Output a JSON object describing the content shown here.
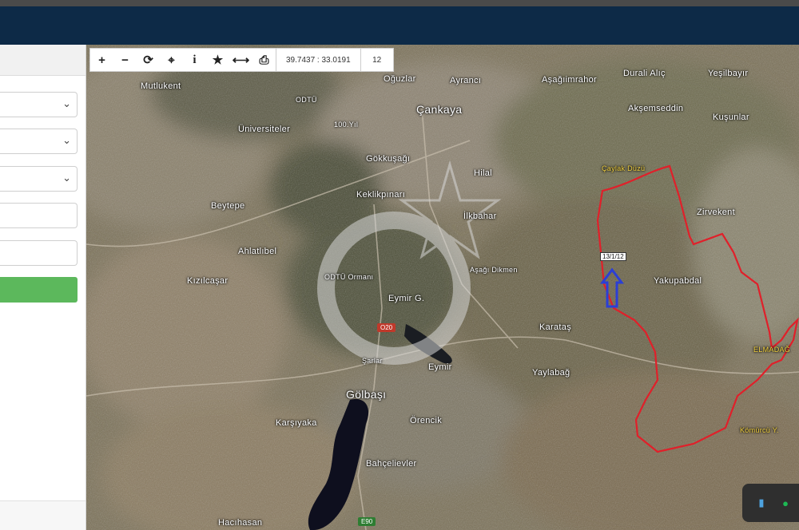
{
  "toolbar": {
    "buttons": [
      {
        "name": "zoom-in-icon",
        "glyph": "+"
      },
      {
        "name": "zoom-out-icon",
        "glyph": "−"
      },
      {
        "name": "refresh-icon",
        "glyph": "⟳"
      },
      {
        "name": "locate-icon",
        "glyph": "⌖"
      },
      {
        "name": "info-icon",
        "glyph": "i"
      },
      {
        "name": "favorite-star-icon",
        "glyph": "★"
      },
      {
        "name": "measure-icon",
        "glyph": "⟷"
      },
      {
        "name": "print-icon",
        "glyph": "⎙"
      }
    ],
    "coordinates": "39.7437 : 33.0191",
    "zoom": "12"
  },
  "map": {
    "labels": {
      "mutlukent": "Mutlukent",
      "odtu": "ODTÜ",
      "universiteler": "Üniversiteler",
      "yuzuncu_yil": "100.Yıl",
      "oguzlar": "Oğuzlar",
      "ayranci": "Ayrancı",
      "cankaya": "Çankaya",
      "asagi_imrahor": "Aşağıimrahor",
      "durali_alic": "Durali Alıç",
      "yesilbayir": "Yeşilbayır",
      "aksemseddin": "Akşemseddin",
      "kusunlar": "Kuşunlar",
      "gokkusagi": "Gökkuşağı",
      "hilal": "Hilal",
      "caylak_duzu": "Çaylak Düzü",
      "keklikpinari": "Keklikpınarı",
      "ikbahar": "İlkbahar",
      "beytepe": "Beytepe",
      "zirvekent": "Zirvekent",
      "ahlatlibel": "Ahlatlıbel",
      "odtu_ormani": "ODTÜ Ormanı",
      "asagi_dikmen": "Aşağı Dikmen",
      "yakupabdal": "Yakupabdal",
      "kizilcasar": "Kızılcaşar",
      "eymir_golu": "Eymir G.",
      "karatas": "Karataş",
      "elmadag": "ELMADAĞ",
      "sarlar": "Şarlar",
      "eymir": "Eymir",
      "yaylabag": "Yaylabağ",
      "golbasi": "Gölbaşı",
      "karsiyaka": "Karşıyaka",
      "orencik": "Örencik",
      "komurcu": "Kömürcü Y.",
      "bahcelievler": "Bahçelievler",
      "hacihasan": "Hacıhasan"
    },
    "road_badges": {
      "o20": "O20",
      "e90": "E90"
    },
    "parcel_tag": "13/1/12",
    "boundary_color": "#e0202a",
    "marker_color": "#2b3fd6"
  },
  "sidebar": {
    "accent_button_color": "#5cb85c"
  },
  "widget": {
    "icons": [
      "book-app-icon",
      "spotify-icon"
    ]
  }
}
